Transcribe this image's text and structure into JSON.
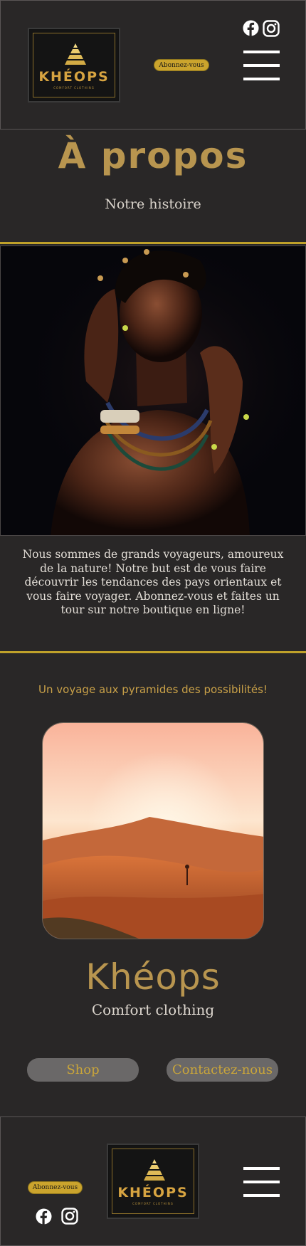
{
  "header": {
    "logo": {
      "word": "KHÉOPS",
      "sub": "COMFORT CLOTHING"
    },
    "subscribe_label": "Abonnez-vous",
    "social": [
      "facebook-icon",
      "instagram-icon"
    ],
    "menu_icon": "hamburger-menu-icon"
  },
  "about": {
    "title": "À propos",
    "subtitle": "Notre histoire",
    "text": "Nous sommes de grands voyageurs, amoureux de la nature! Notre but est de vous faire découvrir les tendances des pays orientaux et vous faire voyager. Abonnez-vous et faites un tour sur notre boutique en ligne!"
  },
  "promo": {
    "tagline": "Un voyage aux pyramides des possibilités!",
    "brand": "Khéops",
    "brand_sub": "Comfort clothing",
    "shop_label": "Shop",
    "contact_label": "Contactez-nous"
  },
  "footer": {
    "subscribe_label": "Abonnez-vous",
    "logo": {
      "word": "KHÉOPS",
      "sub": "COMFORT CLOTHING"
    }
  },
  "colors": {
    "background": "#292727",
    "gold": "#b8954f",
    "accent_rule": "#bfa12a",
    "button_bg": "#6a6868"
  }
}
